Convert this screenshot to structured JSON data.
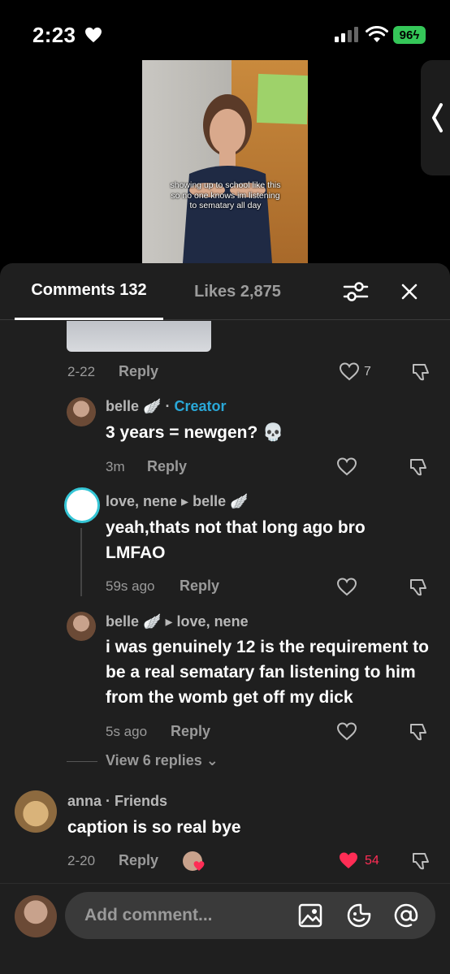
{
  "status_bar": {
    "time": "2:23",
    "battery": "96"
  },
  "video": {
    "caption": "showing up to school like this so no one knows im listening to sematary all day"
  },
  "tabs": {
    "comments": "Comments 132",
    "likes": "Likes 2,875"
  },
  "comments": [
    {
      "date": "2-22",
      "reply_label": "Reply",
      "likes": "7"
    },
    {
      "author": "belle",
      "creator_tag": "Creator",
      "text": "3 years = newgen? 💀",
      "time": "3m",
      "reply_label": "Reply"
    },
    {
      "author": "love, nene",
      "reply_to": "belle",
      "text": "yeah,thats not that long ago bro LMFAO",
      "time": "59s ago",
      "reply_label": "Reply"
    },
    {
      "author": "belle",
      "reply_to": "love, nene",
      "text": "i was genuinely 12 is the requirement to be a real sematary fan listening to him from the womb get off my dick",
      "time": "5s ago",
      "reply_label": "Reply"
    },
    {
      "view_replies": "View 6 replies"
    },
    {
      "author": "anna",
      "tag": "Friends",
      "text": "caption is so real bye",
      "date": "2-20",
      "reply_label": "Reply",
      "likes": "54"
    }
  ],
  "composer": {
    "placeholder": "Add comment..."
  },
  "colors": {
    "accent_blue": "#2aa8d8",
    "like_red": "#ff2d55",
    "battery_green": "#35c759"
  }
}
